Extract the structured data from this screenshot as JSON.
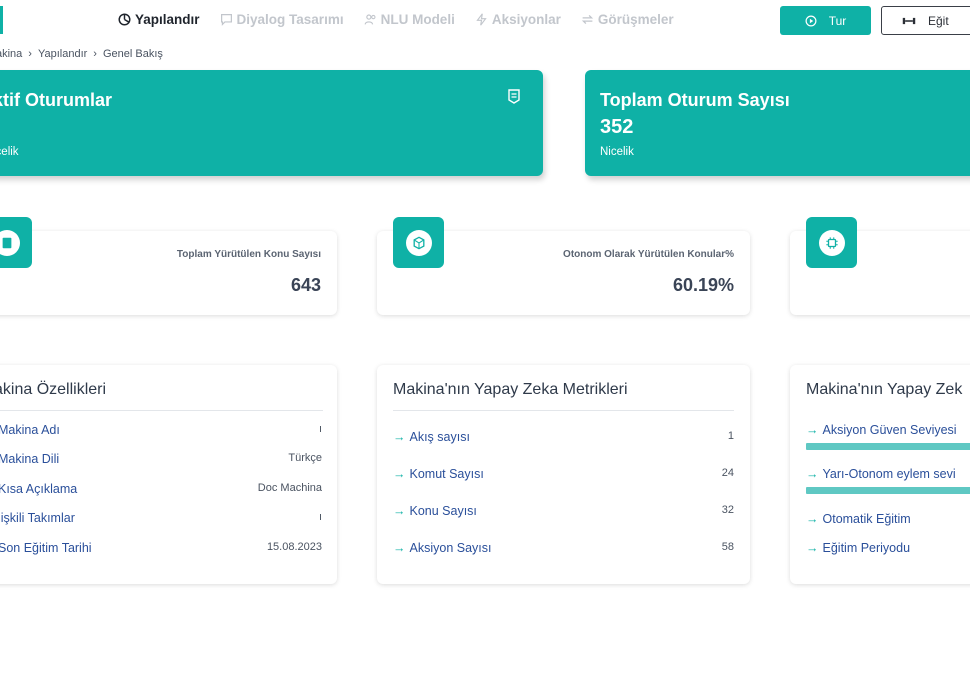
{
  "nav": {
    "items": [
      {
        "label": "Yapılandır",
        "icon": "pie-chart-icon",
        "active": true
      },
      {
        "label": "Diyalog Tasarımı",
        "icon": "chat-bubble-icon",
        "active": false
      },
      {
        "label": "NLU Modeli",
        "icon": "users-icon",
        "active": false
      },
      {
        "label": "Aksiyonlar",
        "icon": "lightning-icon",
        "active": false
      },
      {
        "label": "Görüşmeler",
        "icon": "repeat-icon",
        "active": false
      }
    ],
    "tour_label": "Tur",
    "train_label": "Eğit"
  },
  "breadcrumb": [
    "akina",
    "Yapılandır",
    "Genel Bakış"
  ],
  "big_cards": [
    {
      "title": "ktif Oturumlar",
      "value": "",
      "sub": "icelik",
      "icon": "list-icon"
    },
    {
      "title": "Toplam Oturum Sayısı",
      "value": "352",
      "sub": "Nicelik"
    }
  ],
  "stats": [
    {
      "label": "Toplam Yürütülen Konu Sayısı",
      "value": "643",
      "icon": "book-icon"
    },
    {
      "label": "Otonom Olarak Yürütülen Konular%",
      "value": "60.19%",
      "icon": "hexagon-icon"
    },
    {
      "label": "",
      "value": "",
      "icon": "chip-icon"
    }
  ],
  "machine_features": {
    "title": "akina Özellikleri",
    "rows": [
      {
        "label": "Makina Adı",
        "value": "ı"
      },
      {
        "label": "Makina Dili",
        "value": "Türkçe"
      },
      {
        "label": "Kısa Açıklama",
        "value": "Doc Machina"
      },
      {
        "label": "lişkili Takımlar",
        "value": "ı"
      },
      {
        "label": "Son Eğitim Tarihi",
        "value": "15.08.2023"
      }
    ]
  },
  "ai_metrics": {
    "title": "Makina'nın Yapay Zeka Metrikleri",
    "rows": [
      {
        "label": "Akış sayısı",
        "value": "1"
      },
      {
        "label": "Komut Sayısı",
        "value": "24"
      },
      {
        "label": "Konu Sayısı",
        "value": "32"
      },
      {
        "label": "Aksiyon Sayısı",
        "value": "58"
      }
    ]
  },
  "ai_settings": {
    "title": "Makina'nın Yapay Zek",
    "rows": [
      {
        "label": "Aksiyon Güven Seviyesi"
      },
      {
        "label": "Yarı-Otonom eylem sevi"
      },
      {
        "label": "Otomatik Eğitim"
      },
      {
        "label": "Eğitim Periyodu"
      }
    ]
  },
  "colors": {
    "accent": "#0fb1a6",
    "link": "#2a4f9a"
  }
}
